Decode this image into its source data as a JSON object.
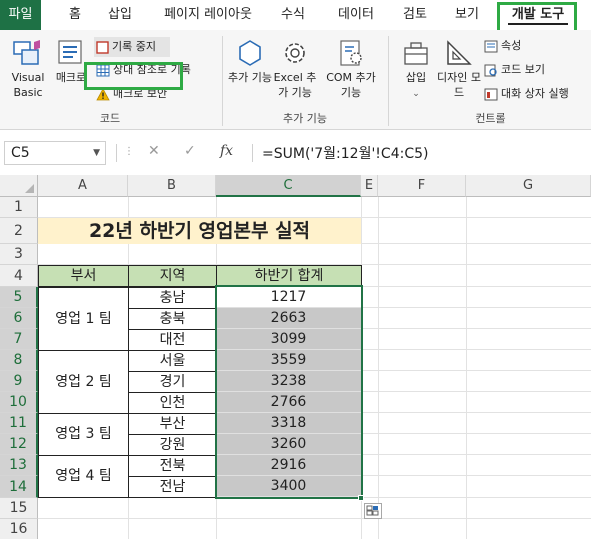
{
  "tabs": [
    "파일",
    "홈",
    "삽입",
    "페이지 레이아웃",
    "수식",
    "데이터",
    "검토",
    "보기",
    "개발 도구"
  ],
  "ribbon": {
    "code": {
      "visual_basic": "Visual Basic",
      "macro": "매크로",
      "record_stop": "기록 중지",
      "relative_ref": "상대 참조로 기록",
      "macro_security": "매크로 보안",
      "label": "코드"
    },
    "addins": {
      "addins": "추가 기능",
      "excel_addins": "Excel 추가 기능",
      "com_addins": "COM 추가 기능",
      "label": "추가 기능"
    },
    "controls": {
      "insert": "삽입",
      "design_mode": "디자인 모드",
      "properties": "속성",
      "view_code": "코드 보기",
      "run_dialog": "대화 상자 실행",
      "label": "컨트롤"
    }
  },
  "formula_bar": {
    "name_box": "C5",
    "fx": "fx",
    "formula": "=SUM('7월:12월'!C4:C5)"
  },
  "grid": {
    "columns": [
      "A",
      "B",
      "C",
      "E",
      "F",
      "G"
    ],
    "rows": [
      "1",
      "2",
      "3",
      "4",
      "5",
      "6",
      "7",
      "8",
      "9",
      "10",
      "11",
      "12",
      "13",
      "14",
      "15",
      "16"
    ],
    "title": "22년 하반기 영업본부 실적",
    "headers": [
      "부서",
      "지역",
      "하반기 합계"
    ],
    "teams": [
      "영업 1 팀",
      "영업 2 팀",
      "영업 3 팀",
      "영업 4 팀"
    ],
    "regions": [
      "충남",
      "충북",
      "대전",
      "서울",
      "경기",
      "인천",
      "부산",
      "강원",
      "전북",
      "전남"
    ],
    "totals": [
      "1217",
      "2663",
      "3099",
      "3559",
      "3238",
      "2766",
      "3318",
      "3260",
      "2916",
      "3400"
    ]
  },
  "colors": {
    "file_tab": "#1e7145",
    "highlight_box": "#2eaa44",
    "selection": "#217346",
    "title_fill": "#fff2cc",
    "header_fill": "#c6e0b4",
    "selected_fill": "#c8c8c8"
  }
}
